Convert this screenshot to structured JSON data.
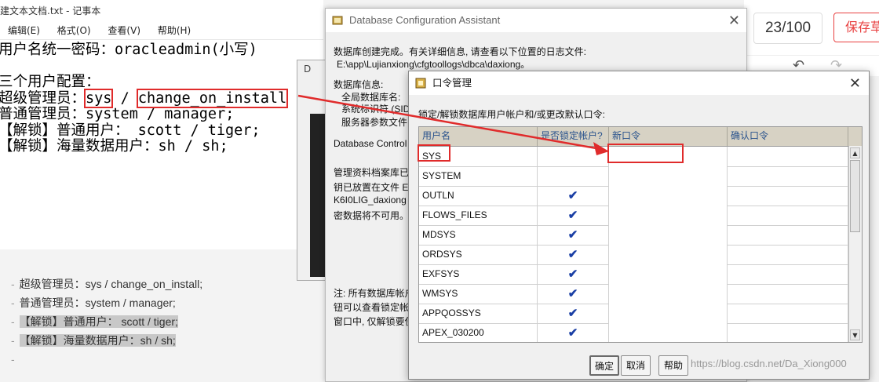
{
  "notepad": {
    "title": "建文本文档.txt - 记事本",
    "menu": [
      "编辑(E)",
      "格式(O)",
      "查看(V)",
      "帮助(H)"
    ],
    "line1": "用户名统一密码：oracleadmin(小写)",
    "line2": "",
    "line3": "三个用户配置：",
    "line4_prefix": "超级管理员：",
    "line4_user": "sys",
    "line4_sep": " / ",
    "line4_pass": "change_on_install",
    "line5": "普通管理员：system / manager;",
    "line6": "【解锁】普通用户： scott / tiger;",
    "line7": "【解锁】海量数据用户：sh / sh;"
  },
  "doc_list": [
    "超级管理员：sys / change_on_install;",
    "普通管理员：system / manager;",
    "【解锁】普通用户： scott / tiger;",
    "【解锁】海量数据用户：sh / sh;",
    ""
  ],
  "editor": {
    "page_count": "23/100",
    "save_label": "保存草"
  },
  "dbca": {
    "title": "Database Configuration Assistant",
    "line1": "数据库创建完成。有关详细信息, 请查看以下位置的日志文件:",
    "line2": "E:\\app\\Lujianxiong\\cfgtoollogs\\dbca\\daxiong。",
    "info_label": "数据库信息:",
    "global_name": "全局数据库名:",
    "sid": "系统标识符 (SID",
    "param_file": "服务器参数文件",
    "control": "Database Control",
    "repo1": "管理资料档案库已",
    "repo2": "钥已放置在文件 E",
    "repo3": "K6I0LIG_daxiong",
    "repo4": "密数据将不可用。",
    "note1": "注: 所有数据库帐户",
    "note2": "钮可以查看锁定帐",
    "note3": "窗口中, 仅解锁要使"
  },
  "bg_dialog": {
    "title": "D"
  },
  "pwd_dialog": {
    "title": "口令管理",
    "desc": "锁定/解锁数据库用户帐户和/或更改默认口令:",
    "columns": [
      "用户名",
      "是否锁定帐户?",
      "新口令",
      "确认口令"
    ],
    "rows": [
      {
        "user": "SYS",
        "locked": false
      },
      {
        "user": "SYSTEM",
        "locked": false
      },
      {
        "user": "OUTLN",
        "locked": true
      },
      {
        "user": "FLOWS_FILES",
        "locked": true
      },
      {
        "user": "MDSYS",
        "locked": true
      },
      {
        "user": "ORDSYS",
        "locked": true
      },
      {
        "user": "EXFSYS",
        "locked": true
      },
      {
        "user": "WMSYS",
        "locked": true
      },
      {
        "user": "APPQOSSYS",
        "locked": true
      },
      {
        "user": "APEX_030200",
        "locked": true
      }
    ],
    "ok": "确定",
    "cancel": "取消",
    "help": "帮助"
  },
  "watermark": "https://blog.csdn.net/Da_Xiong000",
  "colors": {
    "annotation_red": "#e02b2b",
    "check_blue": "#1a3fa5",
    "header_text": "#27518c"
  }
}
